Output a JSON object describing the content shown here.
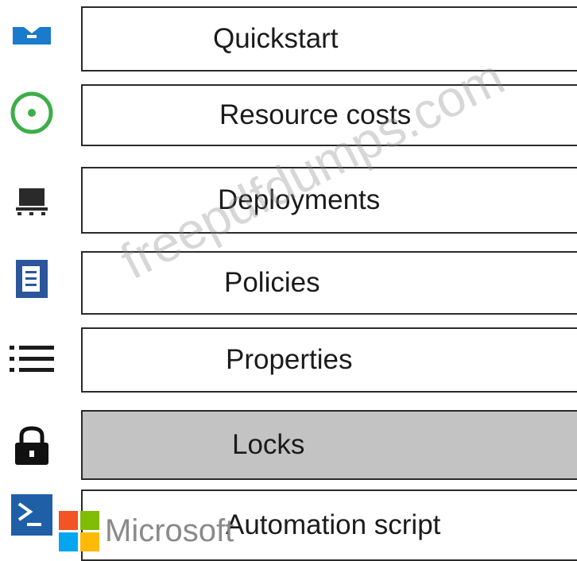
{
  "menu": {
    "items": [
      {
        "label": "Quickstart",
        "icon": "quickstart-icon",
        "selected": false
      },
      {
        "label": "Resource costs",
        "icon": "resource-costs-icon",
        "selected": false
      },
      {
        "label": "Deployments",
        "icon": "deployments-icon",
        "selected": false
      },
      {
        "label": "Policies",
        "icon": "policies-icon",
        "selected": false
      },
      {
        "label": "Properties",
        "icon": "properties-icon",
        "selected": false
      },
      {
        "label": "Locks",
        "icon": "lock-icon",
        "selected": true
      },
      {
        "label": "Automation script",
        "icon": "automation-script-icon",
        "selected": false
      }
    ]
  },
  "watermark": "freepdfdumps.com",
  "branding": {
    "logo_text": "Microsoft"
  },
  "colors": {
    "quickstart_blue": "#1a7acc",
    "resource_costs_green": "#3dae4a",
    "policies_blue": "#2b579a",
    "automation_blue": "#1f5fa8",
    "selected_row_bg": "#c3c3c3",
    "border": "#2a2a2a"
  }
}
